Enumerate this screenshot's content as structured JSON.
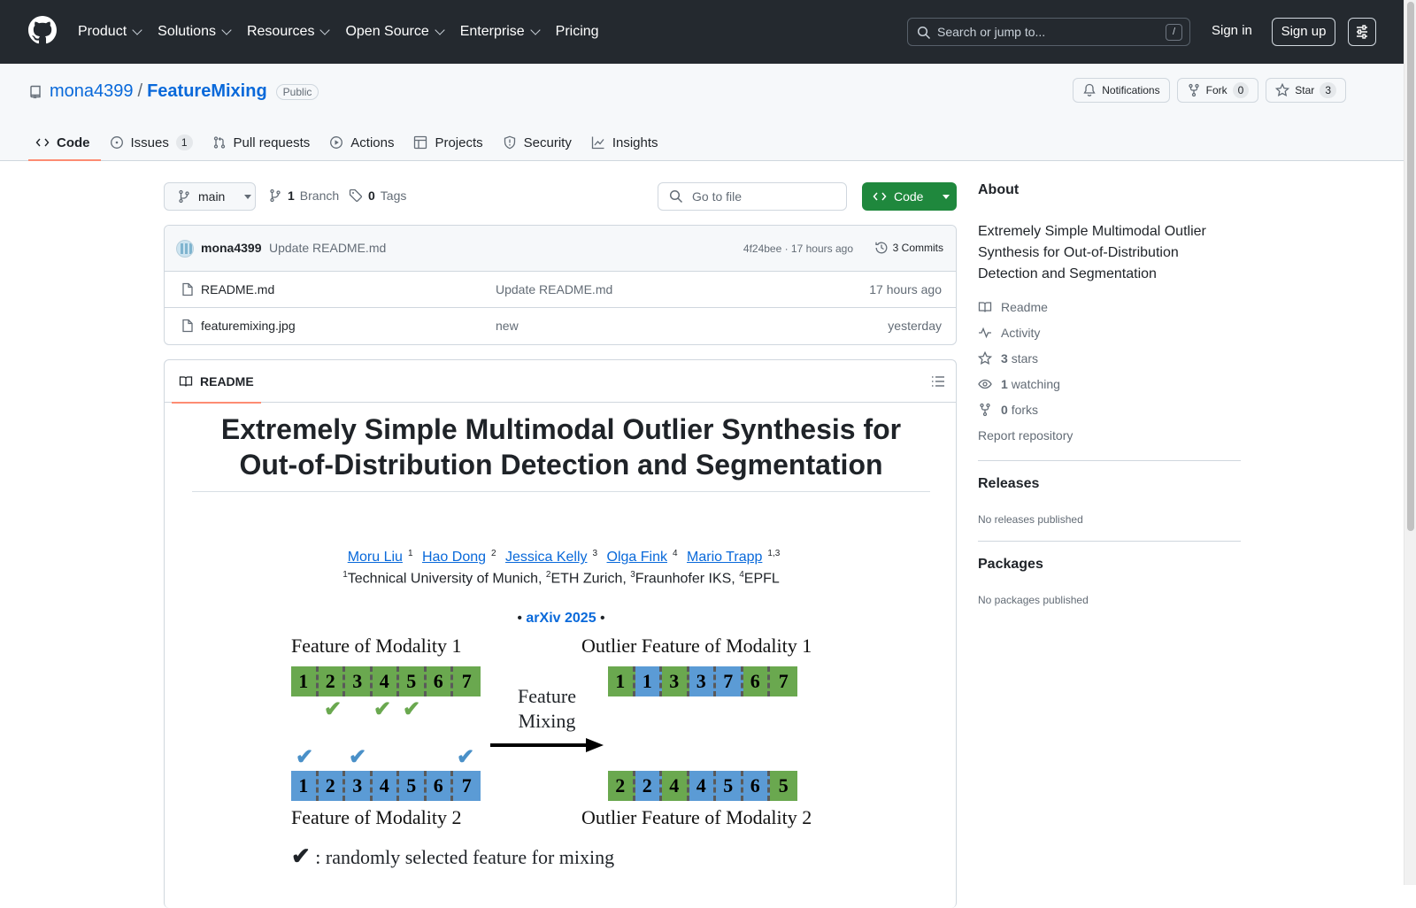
{
  "header": {
    "nav": [
      "Product",
      "Solutions",
      "Resources",
      "Open Source",
      "Enterprise",
      "Pricing"
    ],
    "search_placeholder": "Search or jump to...",
    "search_shortcut": "/",
    "signin": "Sign in",
    "signup": "Sign up"
  },
  "repo": {
    "owner": "mona4399",
    "separator": "/",
    "name": "FeatureMixing",
    "visibility": "Public",
    "notifications_label": "Notifications",
    "fork_label": "Fork",
    "fork_count": "0",
    "star_label": "Star",
    "star_count": "3"
  },
  "tabs": [
    {
      "label": "Code"
    },
    {
      "label": "Issues",
      "count": "1"
    },
    {
      "label": "Pull requests"
    },
    {
      "label": "Actions"
    },
    {
      "label": "Projects"
    },
    {
      "label": "Security"
    },
    {
      "label": "Insights"
    }
  ],
  "toolbar": {
    "branch": "main",
    "branch_count": "1",
    "branch_label": "Branch",
    "tag_count": "0",
    "tag_label": "Tags",
    "goto_placeholder": "Go to file",
    "code_button": "Code"
  },
  "commit": {
    "author": "mona4399",
    "message": "Update README.md",
    "meta": "4f24bee · 17 hours ago",
    "commits": "3 Commits"
  },
  "files": [
    {
      "name": "README.md",
      "message": "Update README.md",
      "time": "17 hours ago"
    },
    {
      "name": "featuremixing.jpg",
      "message": "new",
      "time": "yesterday"
    }
  ],
  "readme": {
    "tab": "README",
    "title": "Extremely Simple Multimodal Outlier Synthesis for Out-of-Distribution Detection and Segmentation",
    "authors": [
      {
        "name": "Moru Liu",
        "sup": "1"
      },
      {
        "name": "Hao Dong",
        "sup": "2"
      },
      {
        "name": "Jessica Kelly",
        "sup": "3"
      },
      {
        "name": "Olga Fink",
        "sup": "4"
      },
      {
        "name": "Mario Trapp",
        "sup": "1,3"
      }
    ],
    "affiliations": [
      {
        "sup": "1",
        "name": "Technical University of Munich,"
      },
      {
        "sup": "2",
        "name": "ETH Zurich,"
      },
      {
        "sup": "3",
        "name": "Fraunhofer IKS,"
      },
      {
        "sup": "4",
        "name": "EPFL"
      }
    ],
    "bullet": "•",
    "venue": "arXiv 2025",
    "figure": {
      "label_m1": "Feature of Modality 1",
      "label_m2": "Feature of Modality 2",
      "label_o1": "Outlier Feature of Modality 1",
      "label_o2": "Outlier Feature of Modality 2",
      "mix_line1": "Feature",
      "mix_line2": "Mixing",
      "check_glyph": "✔",
      "legend_text": ": randomly selected feature for mixing",
      "m1": [
        "1",
        "2",
        "3",
        "4",
        "5",
        "6",
        "7"
      ],
      "m2": [
        "1",
        "2",
        "3",
        "4",
        "5",
        "6",
        "7"
      ],
      "o1": [
        "1",
        "1",
        "3",
        "3",
        "7",
        "6",
        "7"
      ],
      "o2": [
        "2",
        "2",
        "4",
        "4",
        "5",
        "6",
        "5"
      ]
    }
  },
  "about": {
    "title": "About",
    "description": "Extremely Simple Multimodal Outlier Synthesis for Out-of-Distribution Detection and Segmentation",
    "readme": "Readme",
    "activity": "Activity",
    "stars_count": "3",
    "stars_label": "stars",
    "watching_count": "1",
    "watching_label": "watching",
    "forks_count": "0",
    "forks_label": "forks",
    "report": "Report repository"
  },
  "releases": {
    "title": "Releases",
    "empty": "No releases published"
  },
  "packages": {
    "title": "Packages",
    "empty": "No packages published"
  }
}
